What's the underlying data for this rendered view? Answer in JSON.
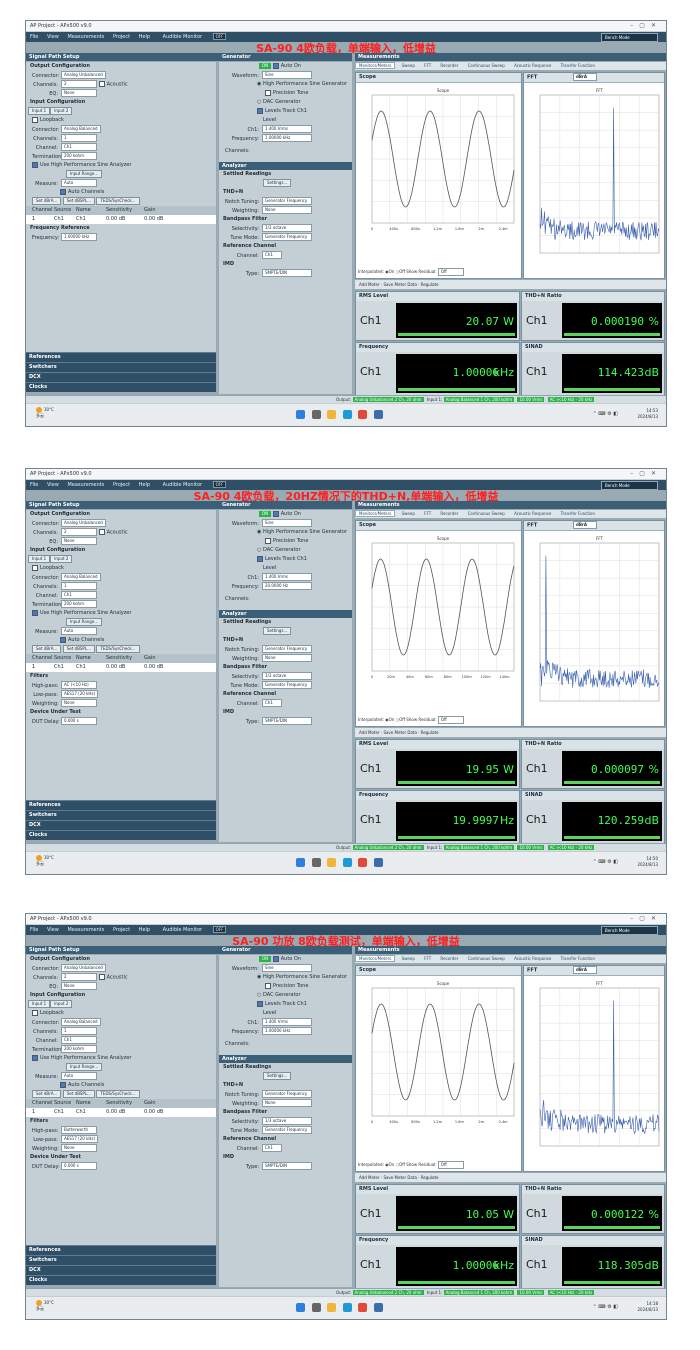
{
  "common": {
    "window_title": "AP Project - APx500 v9.0",
    "menu": [
      "File",
      "View",
      "Measurements",
      "Project",
      "Help"
    ],
    "audible_monitor": "Audible Monitor",
    "monitor_state": "OFF",
    "bench_mode": "Bench Mode",
    "signal_path_setup": "Signal Path Setup",
    "output_config": "Output Configuration",
    "connector_label": "Connector:",
    "output_connector": "Analog Unbalanced",
    "channels_label": "Channels:",
    "output_channels": "2",
    "acoustic": "Acoustic",
    "eq_label": "EQ:",
    "eq_value": "None",
    "input_config": "Input Configuration",
    "input_tabs": [
      "Input 1",
      "Input 2"
    ],
    "loopback": "Loopback",
    "input_connector": "Analog Balanced",
    "input_channels": "1",
    "channel_label": "Channel:",
    "channel_value": "Ch1",
    "termination_label": "Termination:",
    "termination_value": "200 kohm",
    "high_perf_sine_analyzer": "Use High Performance Sine Analyzer",
    "input_range": "Input Range...",
    "measure_label": "Measure:",
    "measure_value": "Auto",
    "auto_channels": "Auto Channels",
    "set_dbr": "Set dBrA...",
    "set_dbspl": "Set dBSPL...",
    "teds": "TEDS/SysCheck...",
    "table_headers": [
      "Channel",
      "Source",
      "Name",
      "Sensitivity",
      "Gain"
    ],
    "table_row": [
      "1",
      "Ch1",
      "Ch1",
      "0.00 dB",
      "0.00 dB"
    ],
    "generator": "Generator",
    "on_label": "ON",
    "auto_on": "Auto On",
    "waveform_label": "Waveform:",
    "waveform_value": "Sine",
    "high_perf_sine_gen": "High Performance Sine Generator",
    "precision_tone": "Precision Tone",
    "dac_generator": "DAC Generator",
    "levels_track": "Levels Track Ch1",
    "level_label": "Level",
    "ch1_label": "Ch1:",
    "level_value": "1.400 Vrms",
    "frequency_label": "Frequency:",
    "channels_short": "Channels:",
    "analyzer": "Analyzer",
    "settled_readings": "Settled Readings",
    "settings_btn": "Settings...",
    "thdn_section": "THD+N",
    "notch_label": "Notch Tuning:",
    "notch_value": "Generator Frequency",
    "weighting_label": "Weighting:",
    "weighting_value": "None",
    "bandpass": "Bandpass Filter",
    "selectivity_label": "Selectivity:",
    "selectivity_value": "1/3 octave",
    "tune_mode_label": "Tune Mode:",
    "tune_mode_value": "Generator Frequency",
    "reference_channel": "Reference Channel",
    "channel_short": "Channel:",
    "imd_section": "IMD",
    "type_label": "Type:",
    "type_value": "SMPTE/DIN",
    "measurements": "Measurements",
    "meas_tabs": [
      "Monitors/Meters",
      "Sweep",
      "FFT",
      "Recorder",
      "Continuous Sweep",
      "Acoustic Response",
      "Transfer Function"
    ],
    "scope": "Scope",
    "scope_title": "Scope",
    "fft": "FFT",
    "fft_title": "FFT",
    "fft_unit": "dBrA",
    "interpolated": "Interpolated:",
    "on": "On",
    "off": "Off",
    "show_residual": "Show Residual:",
    "residual_value": "Off",
    "add_meter": "Add Meter",
    "save_meter_data": "Save Meter Data",
    "regulate": "Regulate",
    "rms_level": "RMS Level",
    "thdn_ratio": "THD+N Ratio",
    "frequency": "Frequency",
    "sinad": "SINAD",
    "ch1": "Ch1",
    "output": "Output:",
    "output_status": "Analog Unbalanced 2 Ch, 20 ohm",
    "input1": "Input 1:",
    "input1_status": "Analog Balanced 1 Ch, 200 kohm",
    "input_level": "10.00 Vrms",
    "input_filter": "AC (<10 Hz) - 20 kHz",
    "input2": "Input 2:",
    "input2_status": "None",
    "references": "References",
    "frequency_reference": "Frequency Reference",
    "switchers": "Switchers",
    "dcx": "DCX",
    "clocks": "Clocks",
    "triggers": "Triggers",
    "filters": "Filters",
    "highpass_label": "High-pass:",
    "lowpass_label": "Low-pass:",
    "lowpass_value": "AES17 (20 kHz)",
    "dut": "Device Under Test",
    "dut_delay_label": "DUT Delay:",
    "dut_delay_value": "0.000 s",
    "weather_temp": "30°C",
    "weather_desc": "多云",
    "date": "2024/8/13"
  },
  "screens": [
    {
      "title": "SA-90 4欧负载，单端输入，低增益",
      "gen_frequency": "1.00000 kHz",
      "rms_value": "20.07",
      "rms_unit": "W",
      "thdn_value": "0.000190",
      "thdn_unit": "%",
      "freq_value": "1.00006",
      "freq_unit": "kHz",
      "sinad_value": "114.423",
      "sinad_unit": "dB",
      "time": "14:53",
      "scope_x_ticks": [
        "0",
        "400u",
        "800u",
        "1.2m",
        "1.6m",
        "2m",
        "2.4m"
      ],
      "cycles": 2.9
    },
    {
      "title": "SA-90   4欧负载，20HZ情况下的THD+N,单端输入，低增益",
      "gen_frequency": "20.0000 Hz",
      "rms_value": "19.95",
      "rms_unit": "W",
      "thdn_value": "0.000097",
      "thdn_unit": "%",
      "freq_value": "19.9997",
      "freq_unit": "Hz",
      "sinad_value": "120.259",
      "sinad_unit": "dB",
      "time": "14:50",
      "scope_x_ticks": [
        "0",
        "20m",
        "40m",
        "60m",
        "80m",
        "100m",
        "120m",
        "140m"
      ],
      "cycles": 3.1,
      "highpass_value": "AC (<10 Hz)"
    },
    {
      "title": "SA-90 功放 8欧负载测试，单端输入，低增益",
      "gen_frequency": "1.00000 kHz",
      "rms_value": "10.05",
      "rms_unit": "W",
      "thdn_value": "0.000122",
      "thdn_unit": "%",
      "freq_value": "1.00006",
      "freq_unit": "kHz",
      "sinad_value": "118.305",
      "sinad_unit": "dB",
      "time": "14:18",
      "scope_x_ticks": [
        "0",
        "400u",
        "800u",
        "1.2m",
        "1.6m",
        "2m",
        "2.4m"
      ],
      "cycles": 2.9,
      "highpass_value": "Butterworth"
    }
  ]
}
